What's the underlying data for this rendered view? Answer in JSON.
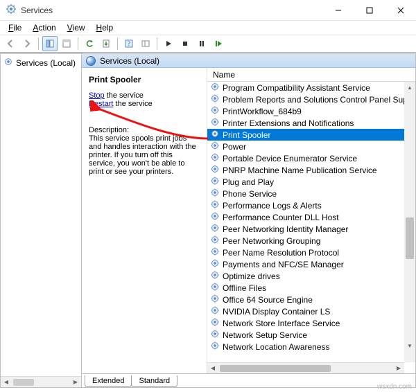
{
  "window": {
    "title": "Services"
  },
  "menubar": {
    "file": "File",
    "action": "Action",
    "view": "View",
    "help": "Help"
  },
  "left": {
    "root": "Services (Local)"
  },
  "right": {
    "header": "Services (Local)",
    "detail": {
      "service_name": "Print Spooler",
      "stop_link": "Stop",
      "stop_after": " the service",
      "restart_link": "Restart",
      "restart_after": " the service",
      "desc_label": "Description:",
      "desc_text": "This service spools print jobs and handles interaction with the printer. If you turn off this service, you won't be able to print or see your printers."
    },
    "columns": {
      "name": "Name"
    },
    "selected_index": 4,
    "services": [
      "Program Compatibility Assistant Service",
      "Problem Reports and Solutions Control Panel Support",
      "PrintWorkflow_684b9",
      "Printer Extensions and Notifications",
      "Print Spooler",
      "Power",
      "Portable Device Enumerator Service",
      "PNRP Machine Name Publication Service",
      "Plug and Play",
      "Phone Service",
      "Performance Logs & Alerts",
      "Performance Counter DLL Host",
      "Peer Networking Identity Manager",
      "Peer Networking Grouping",
      "Peer Name Resolution Protocol",
      "Payments and NFC/SE Manager",
      "Optimize drives",
      "Offline Files",
      "Office 64 Source Engine",
      "NVIDIA Display Container LS",
      "Network Store Interface Service",
      "Network Setup Service",
      "Network Location Awareness"
    ]
  },
  "tabs": {
    "extended": "Extended",
    "standard": "Standard"
  },
  "watermark": "wsxdn.com"
}
